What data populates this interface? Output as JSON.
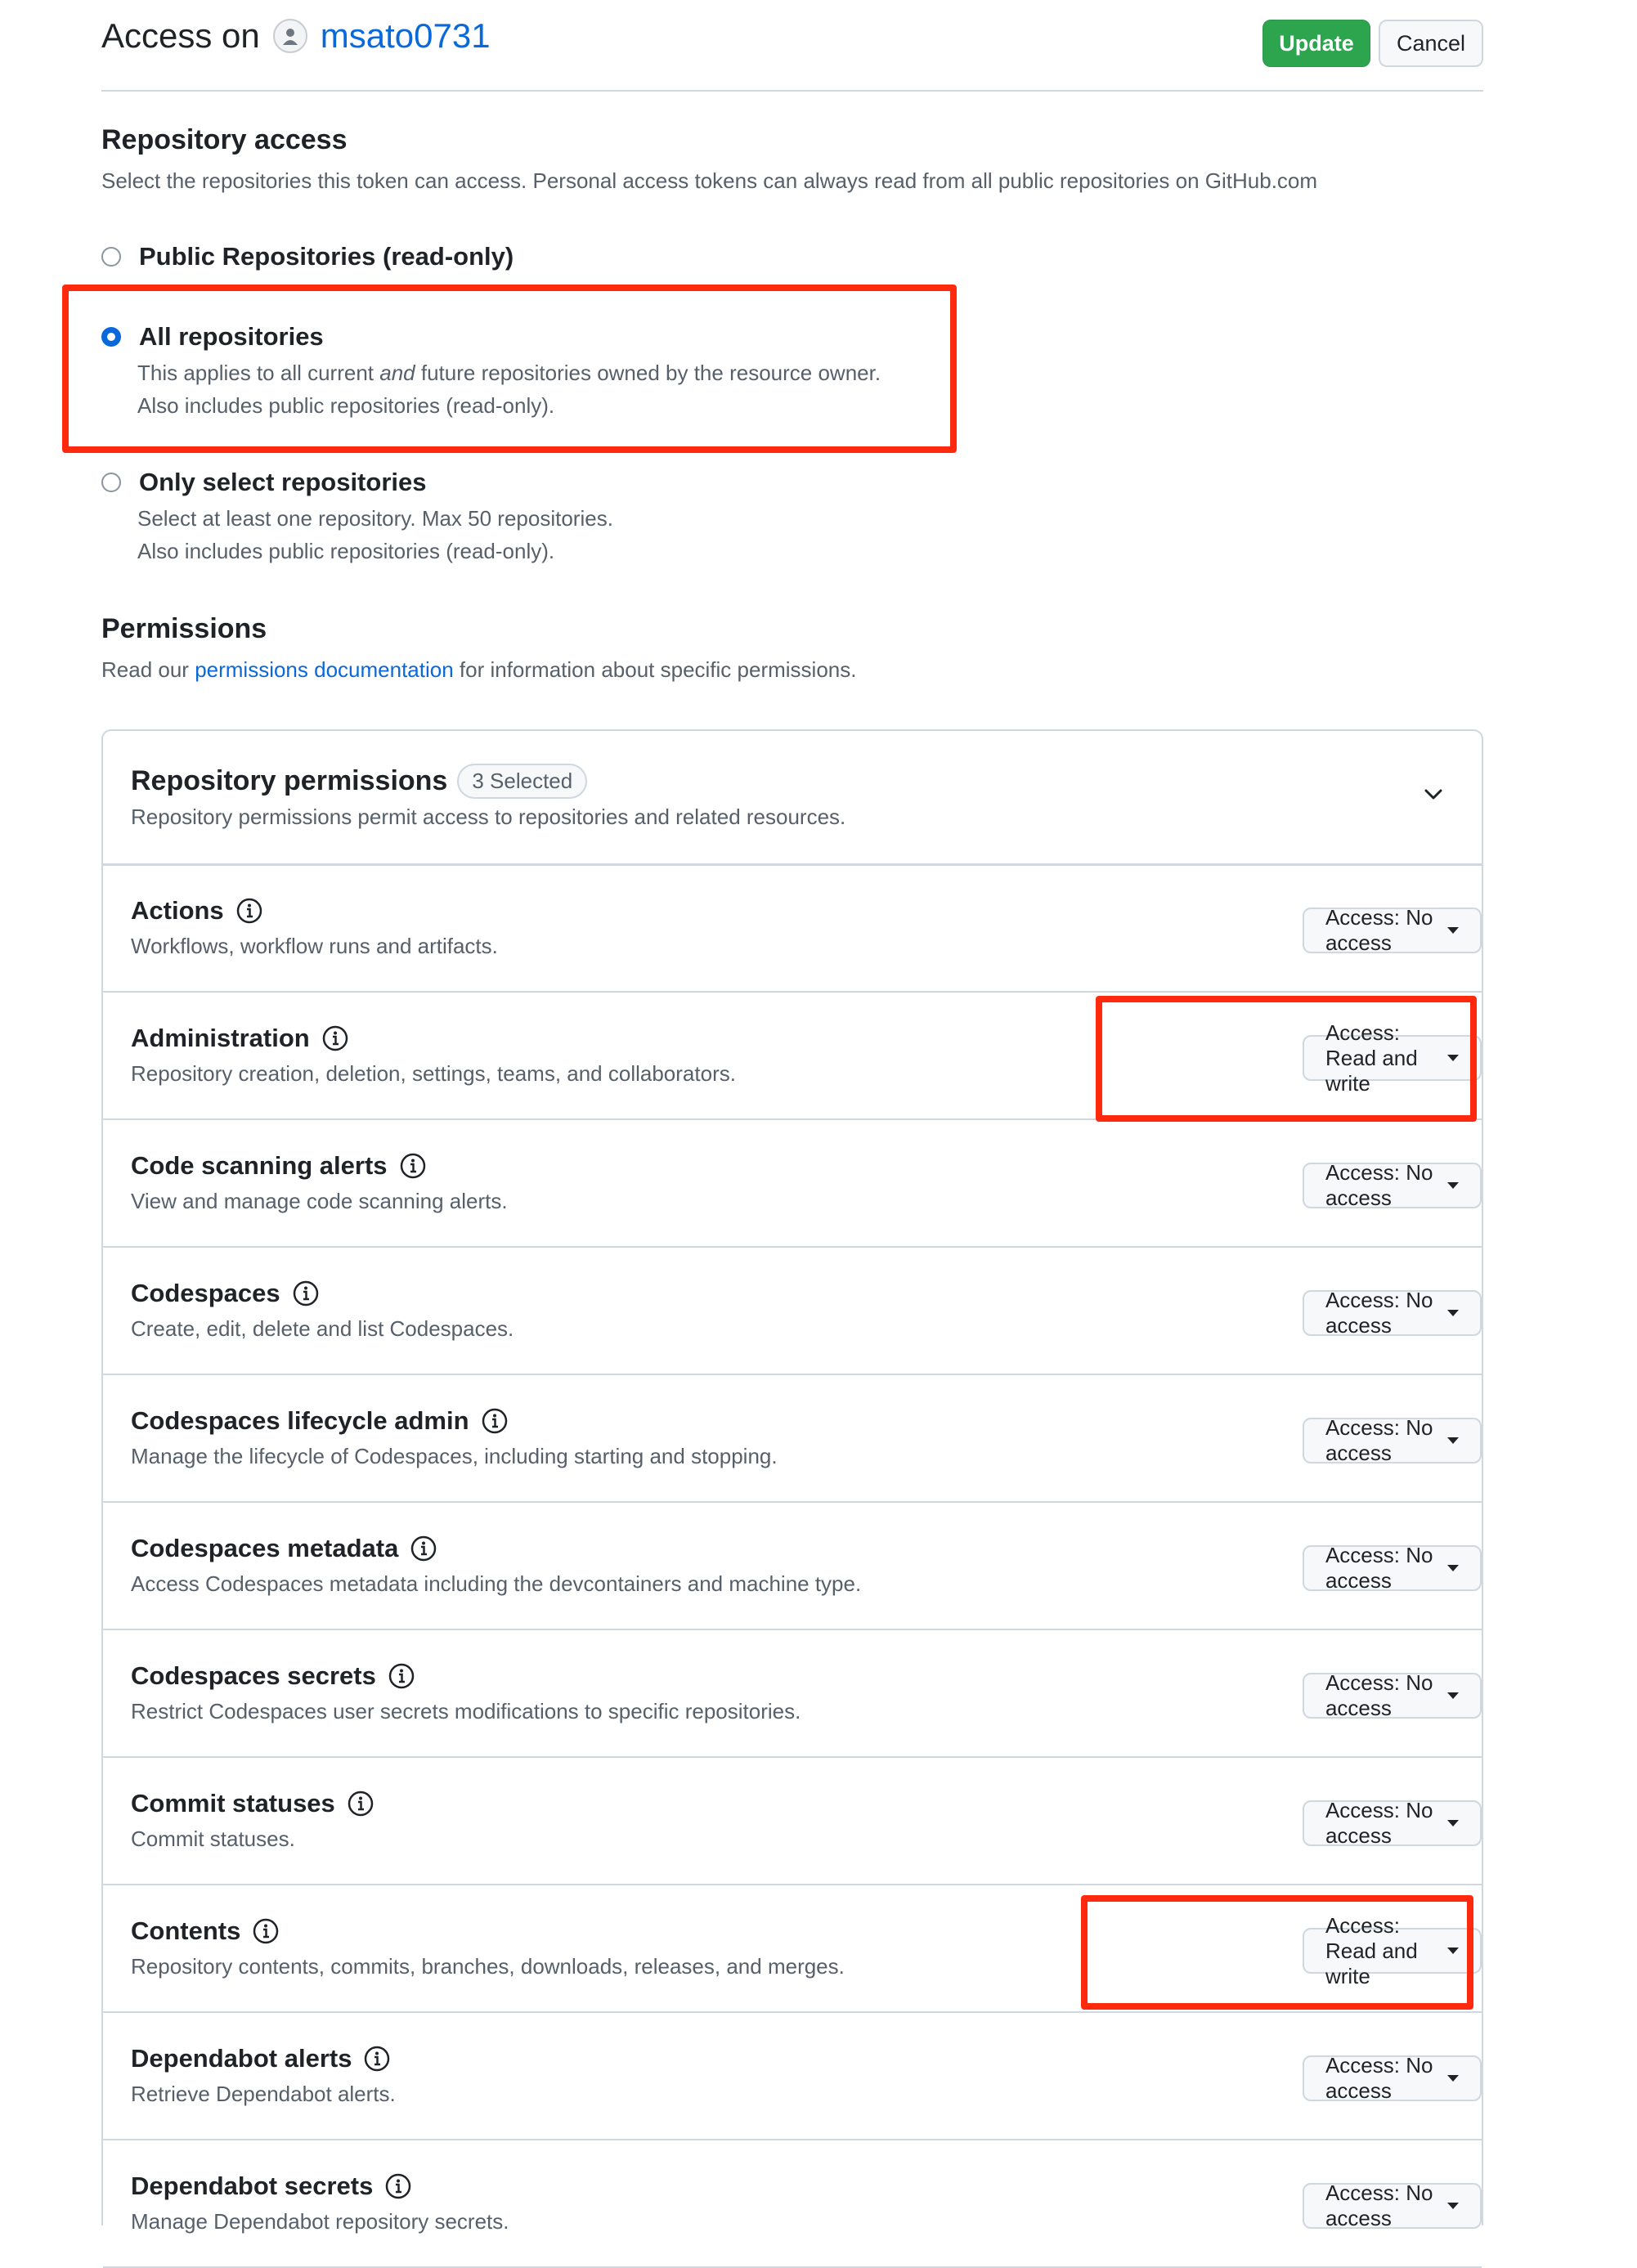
{
  "header": {
    "prefix": "Access on",
    "owner": "msato0731",
    "update_label": "Update",
    "cancel_label": "Cancel"
  },
  "repository_access": {
    "title": "Repository access",
    "description": "Select the repositories this token can access. Personal access tokens can always read from all public repositories on GitHub.com",
    "options": [
      {
        "label": "Public Repositories (read-only)",
        "checked": false,
        "desc1": "",
        "desc2": ""
      },
      {
        "label": "All repositories",
        "checked": true,
        "desc1_a": "This applies to all current ",
        "desc1_em": "and",
        "desc1_b": " future repositories owned by the resource owner.",
        "desc2": "Also includes public repositories (read-only)."
      },
      {
        "label": "Only select repositories",
        "checked": false,
        "desc1": "Select at least one repository. Max 50 repositories.",
        "desc2": "Also includes public repositories (read-only)."
      }
    ]
  },
  "permissions": {
    "title": "Permissions",
    "desc_prefix": "Read our ",
    "desc_link": "permissions documentation",
    "desc_suffix": " for information about specific permissions."
  },
  "repo_permissions": {
    "title": "Repository permissions",
    "badge": "3 Selected",
    "description": "Repository permissions permit access to repositories and related resources.",
    "rows": [
      {
        "name": "Actions",
        "desc": "Workflows, workflow runs and artifacts.",
        "access": "Access: No access"
      },
      {
        "name": "Administration",
        "desc": "Repository creation, deletion, settings, teams, and collaborators.",
        "access": "Access: Read and write"
      },
      {
        "name": "Code scanning alerts",
        "desc": "View and manage code scanning alerts.",
        "access": "Access: No access"
      },
      {
        "name": "Codespaces",
        "desc": "Create, edit, delete and list Codespaces.",
        "access": "Access: No access"
      },
      {
        "name": "Codespaces lifecycle admin",
        "desc": "Manage the lifecycle of Codespaces, including starting and stopping.",
        "access": "Access: No access"
      },
      {
        "name": "Codespaces metadata",
        "desc": "Access Codespaces metadata including the devcontainers and machine type.",
        "access": "Access: No access"
      },
      {
        "name": "Codespaces secrets",
        "desc": "Restrict Codespaces user secrets modifications to specific repositories.",
        "access": "Access: No access"
      },
      {
        "name": "Commit statuses",
        "desc": "Commit statuses.",
        "access": "Access: No access"
      },
      {
        "name": "Contents",
        "desc": "Repository contents, commits, branches, downloads, releases, and merges.",
        "access": "Access: Read and write"
      },
      {
        "name": "Dependabot alerts",
        "desc": "Retrieve Dependabot alerts.",
        "access": "Access: No access"
      },
      {
        "name": "Dependabot secrets",
        "desc": "Manage Dependabot repository secrets.",
        "access": "Access: No access"
      }
    ]
  },
  "colors": {
    "accent": "#0969da",
    "update": "#2da44e",
    "highlight": "#ff2a0e"
  }
}
